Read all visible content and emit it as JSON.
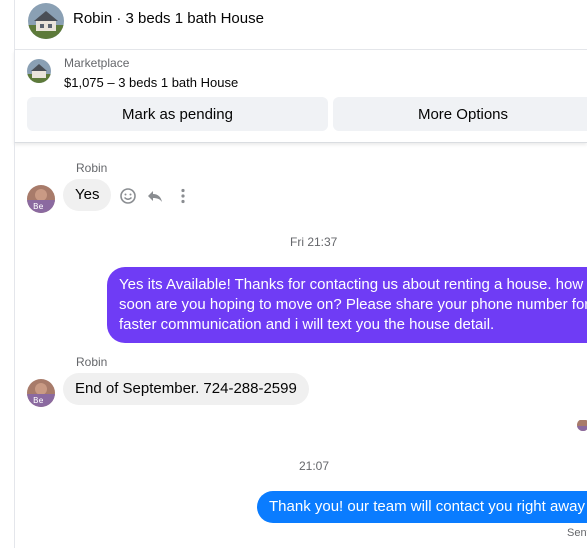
{
  "header": {
    "title": "Robin · 3 beds 1 bath House"
  },
  "listing": {
    "label": "Marketplace",
    "title": "$1,075 – 3 beds 1 bath House"
  },
  "actions": {
    "pending_label": "Mark as pending",
    "more_label": "More Options"
  },
  "messages": [
    {
      "sender": "Robin",
      "text": "Yes"
    },
    {
      "timestamp": "Fri 21:37"
    },
    {
      "lines": [
        "Yes its Available! Thanks for contacting us about renting a house. how",
        "soon are you hoping to move on? Please share your phone number for",
        "faster communication and i will text you the house detail."
      ]
    },
    {
      "sender": "Robin",
      "text": "End of September. 724-288-2599"
    },
    {
      "timestamp": "21:07"
    },
    {
      "text": "Thank you! our team will contact you right away",
      "status": "Sent"
    }
  ],
  "avatar_initials": "Be",
  "colors": {
    "purple_bubble": "#6f3cf5",
    "blue_bubble": "#0a7cff",
    "incoming_bubble": "#f0f0f0"
  },
  "icons": [
    "house-thumbnail",
    "emoji-icon",
    "reply-icon",
    "more-vertical-icon"
  ]
}
